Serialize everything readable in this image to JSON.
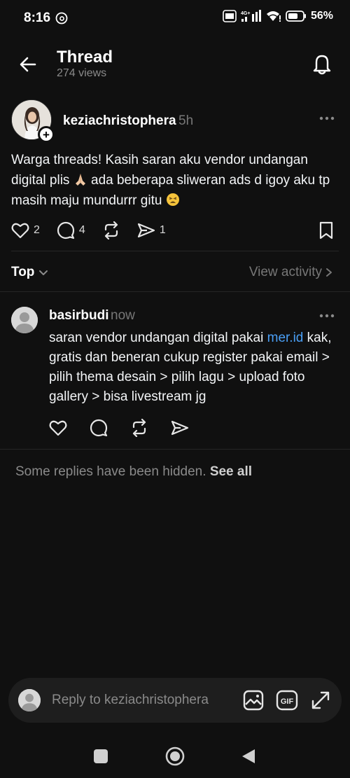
{
  "status_bar": {
    "time": "8:16",
    "network": "4G+",
    "volte": "Vo LTE",
    "battery": "56%"
  },
  "header": {
    "title": "Thread",
    "views": "274 views"
  },
  "post": {
    "username": "keziachristophera",
    "time": "5h",
    "text_part1": "Warga threads! Kasih saran aku vendor undangan digital plis ",
    "text_part2": " ada beberapa sliweran ads d igoy aku tp masih maju mundurrr gitu ",
    "likes": "2",
    "replies": "4",
    "shares": "1"
  },
  "sort": {
    "label": "Top",
    "view_activity": "View activity"
  },
  "reply": {
    "username": "basirbudi",
    "time": "now",
    "text_part1": "saran vendor undangan digital pakai ",
    "link": "mer.id",
    "text_part2": " kak, gratis dan beneran cukup register pakai email > pilih thema desain >  pilih lagu > upload foto gallery > bisa livestream jg"
  },
  "hidden_note": {
    "text": "Some replies have been hidden. ",
    "see_all": "See all"
  },
  "composer": {
    "placeholder": "Reply to keziachristophera"
  },
  "colors": {
    "background": "#101010",
    "text": "#f3f5f7",
    "muted": "#777777",
    "link": "#4a9ff5",
    "composer_bg": "#1e1e1e"
  },
  "icons": [
    "back-arrow-icon",
    "bell-icon",
    "more-icon",
    "heart-icon",
    "comment-icon",
    "repost-icon",
    "send-icon",
    "bookmark-icon",
    "chevron-down-icon",
    "chevron-right-icon",
    "image-icon",
    "gif-icon",
    "expand-icon"
  ]
}
